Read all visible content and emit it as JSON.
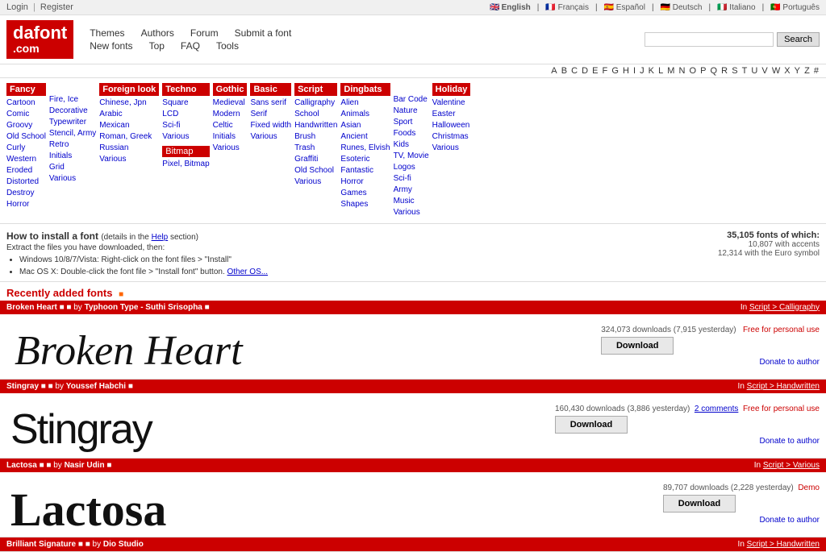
{
  "topbar": {
    "login": "Login",
    "register": "Register",
    "separator": "|",
    "languages": [
      {
        "code": "en",
        "label": "English",
        "active": true
      },
      {
        "code": "fr",
        "label": "Français"
      },
      {
        "code": "es",
        "label": "Español"
      },
      {
        "code": "de",
        "label": "Deutsch"
      },
      {
        "code": "it",
        "label": "Italiano"
      },
      {
        "code": "pt",
        "label": "Português"
      }
    ]
  },
  "logo": {
    "line1": "dafont",
    "line2": ".com"
  },
  "nav": {
    "row1": [
      {
        "label": "Themes"
      },
      {
        "label": "Authors"
      },
      {
        "label": "Forum"
      },
      {
        "label": "Submit a font"
      }
    ],
    "row2": [
      {
        "label": "New fonts"
      },
      {
        "label": "Top"
      },
      {
        "label": "FAQ"
      },
      {
        "label": "Tools"
      }
    ]
  },
  "search": {
    "placeholder": "",
    "button": "Search"
  },
  "alpha_bar": "A B C D E F G H I J K L M N O P Q R S T U V W X Y Z #",
  "categories": {
    "fancy": {
      "header": "Fancy",
      "items": [
        "Cartoon",
        "Comic",
        "Groovy",
        "Old School",
        "Curly",
        "Western",
        "Eroded",
        "Distorted",
        "Destroy",
        "Horror"
      ]
    },
    "fancy2": {
      "items": [
        "Fire, Ice",
        "Decorative",
        "Typewriter",
        "Stencil, Army",
        "Retro",
        "Initials",
        "Grid",
        "Various"
      ]
    },
    "foreign": {
      "header": "Foreign look",
      "items": [
        "Chinese, Jpn",
        "Arabic",
        "Mexican",
        "Roman, Greek",
        "Russian",
        "Various"
      ]
    },
    "techno": {
      "header": "Techno",
      "items": [
        "Square",
        "LCD",
        "Sci-fi",
        "Various"
      ],
      "bitmap_header": "Bitmap",
      "bitmap_items": [
        "Pixel, Bitmap"
      ]
    },
    "gothic": {
      "header": "Gothic",
      "items": [
        "Medieval",
        "Modern",
        "Celtic",
        "Initials",
        "Various"
      ]
    },
    "basic": {
      "header": "Basic",
      "items": [
        "Sans serif",
        "Serif",
        "Fixed width",
        "Various"
      ]
    },
    "script": {
      "header": "Script",
      "items": [
        "Calligraphy",
        "School",
        "Handwritten",
        "Brush",
        "Trash",
        "Graffiti",
        "Old School",
        "Various"
      ]
    },
    "dingbats": {
      "header": "Dingbats",
      "items": [
        "Alien",
        "Animals",
        "Asian",
        "Ancient",
        "Runes, Elvish",
        "Esoteric",
        "Fantastic",
        "Horror",
        "Games",
        "Shapes"
      ]
    },
    "dingbats2": {
      "items": [
        "Bar Code",
        "Nature",
        "Sport",
        "Foods",
        "Kids",
        "TV, Movie",
        "Logos",
        "Sci-fi",
        "Army",
        "Music",
        "Various"
      ]
    },
    "holiday": {
      "header": "Holiday",
      "items": [
        "Valentine",
        "Easter",
        "Halloween",
        "Christmas",
        "Various"
      ]
    }
  },
  "install": {
    "title": "How to install a font",
    "details_prefix": "(details in the ",
    "details_link": "Help",
    "details_suffix": " section)",
    "intro": "Extract the files you have downloaded, then:",
    "steps": [
      "Windows 10/8/7/Vista: Right-click on the font files > \"Install\"",
      "Mac OS X: Double-click the font file > \"Install font\" button. Other OS..."
    ],
    "stats": {
      "total": "35,105 fonts of which:",
      "with_accents": "10,807 with accents",
      "with_euro": "12,314 with the Euro symbol"
    }
  },
  "recently_added": {
    "title": "Recently added fonts"
  },
  "fonts": [
    {
      "id": "broken-heart",
      "name": "Broken Heart",
      "author": "Typhoon Type - Suthi Srisopha",
      "category": "Script > Calligraphy",
      "downloads": "324,073 downloads (7,915 yesterday)",
      "license": "Free for personal use",
      "comments": "",
      "download_label": "Download",
      "donate_label": "Donate to author",
      "preview_type": "script-cursive",
      "preview_text": "Broken Heart"
    },
    {
      "id": "stingray",
      "name": "Stingray",
      "author": "Youssef Habchi",
      "category": "Script > Handwritten",
      "downloads": "160,430 downloads (3,886 yesterday)",
      "comments": "2 comments",
      "license": "Free for personal use",
      "download_label": "Download",
      "donate_label": "Donate to author",
      "preview_type": "brush",
      "preview_text": "Stingray"
    },
    {
      "id": "lactosa",
      "name": "Lactosa",
      "author": "Nasir Udin",
      "category": "Script > Various",
      "downloads": "89,707 downloads (2,228 yesterday)",
      "comments": "",
      "license": "Demo",
      "download_label": "Download",
      "donate_label": "Donate to author",
      "preview_type": "serif-bold",
      "preview_text": "Lactosa"
    }
  ],
  "bottom_font": {
    "name": "Brilliant Signature",
    "author": "Dio Studio",
    "category": "Script > Handwritten"
  }
}
